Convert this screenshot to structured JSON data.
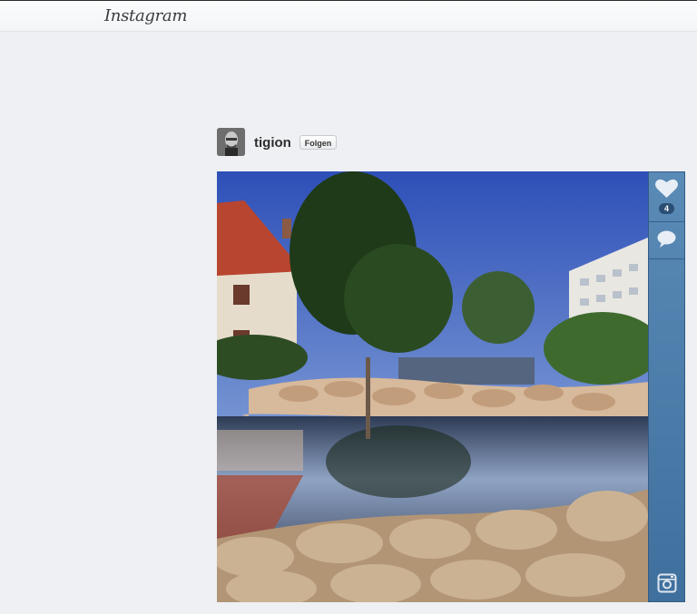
{
  "app": {
    "logo_text": "Instagram"
  },
  "post": {
    "username": "tigion",
    "follow_label": "Folgen",
    "like_count": "4"
  },
  "colors": {
    "sidebar": "#4f7fac",
    "background": "#eef0f3"
  },
  "icons": {
    "like": "heart-icon",
    "comment": "comment-bubble-icon",
    "instagram": "instagram-camera-icon"
  }
}
